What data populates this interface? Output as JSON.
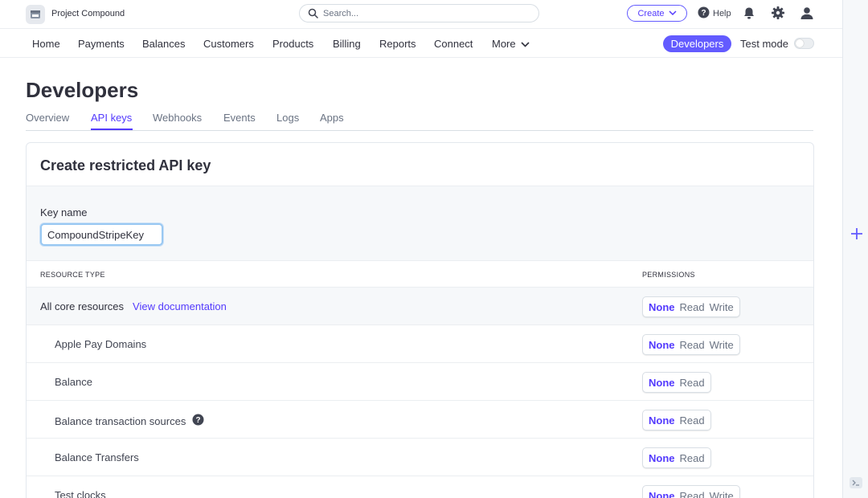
{
  "topbar": {
    "account_name": "Project Compound",
    "search_placeholder": "Search...",
    "create_label": "Create",
    "help_label": "Help"
  },
  "nav": {
    "items": [
      "Home",
      "Payments",
      "Balances",
      "Customers",
      "Products",
      "Billing",
      "Reports",
      "Connect"
    ],
    "more_label": "More",
    "developers_label": "Developers",
    "test_mode_label": "Test mode",
    "test_mode_on": false
  },
  "page": {
    "title": "Developers",
    "tabs": [
      "Overview",
      "API keys",
      "Webhooks",
      "Events",
      "Logs",
      "Apps"
    ],
    "active_tab": "API keys"
  },
  "card": {
    "title": "Create restricted API key",
    "key_name_label": "Key name",
    "key_name_value": "CompoundStripeKey",
    "col_resource": "RESOURCE TYPE",
    "col_permissions": "PERMISSIONS",
    "core_label": "All core resources",
    "core_link": "View documentation",
    "rows": [
      {
        "label": "All core resources",
        "options": [
          "None",
          "Read",
          "Write"
        ],
        "selected": "None"
      },
      {
        "label": "Apple Pay Domains",
        "options": [
          "None",
          "Read",
          "Write"
        ],
        "selected": "None"
      },
      {
        "label": "Balance",
        "options": [
          "None",
          "Read"
        ],
        "selected": "None"
      },
      {
        "label": "Balance transaction sources",
        "options": [
          "None",
          "Read"
        ],
        "selected": "None"
      },
      {
        "label": "Balance Transfers",
        "options": [
          "None",
          "Read"
        ],
        "selected": "None"
      },
      {
        "label": "Test clocks",
        "options": [
          "None",
          "Read",
          "Write"
        ],
        "selected": "None"
      }
    ]
  },
  "colors": {
    "accent": "#635bff",
    "accent_text": "#533afd",
    "text": "#30313d",
    "muted": "#6a7383"
  }
}
